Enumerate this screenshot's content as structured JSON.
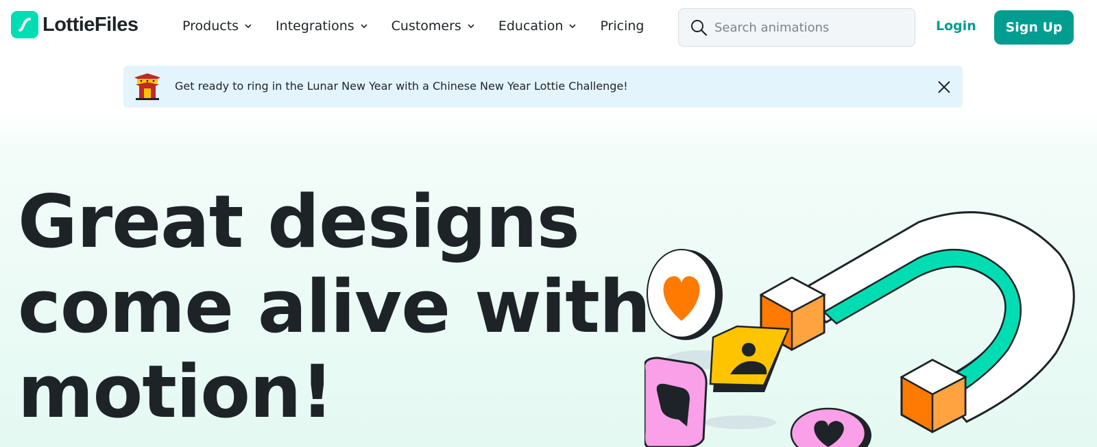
{
  "brand": {
    "name": "LottieFiles",
    "accent": "#00ddb3",
    "primary": "#019d91",
    "text": "#1d2327"
  },
  "nav": {
    "items": [
      {
        "label": "Products",
        "has_dropdown": true
      },
      {
        "label": "Integrations",
        "has_dropdown": true
      },
      {
        "label": "Customers",
        "has_dropdown": true
      },
      {
        "label": "Education",
        "has_dropdown": true
      },
      {
        "label": "Pricing",
        "has_dropdown": false
      }
    ]
  },
  "search": {
    "placeholder": "Search animations",
    "value": "",
    "icon": "search-icon"
  },
  "auth": {
    "login_label": "Login",
    "signup_label": "Sign Up"
  },
  "banner": {
    "icon": "chinese-temple-icon",
    "text": "Get ready to ring in the Lunar New Year with a Chinese New Year Lottie Challenge!",
    "close_icon": "close-icon",
    "background": "#e4f4fc"
  },
  "hero": {
    "title_lines": [
      "Great designs",
      "come alive with",
      "motion!"
    ]
  },
  "illustration": {
    "icons": [
      "magnet-icon",
      "heart-icon",
      "user-icon",
      "chat-bubble-icon",
      "heart-bubble-icon"
    ],
    "colors": {
      "teal": "#00ddb3",
      "orange": "#ff7a00",
      "yellow": "#ffc400",
      "pink": "#f9a0e8"
    }
  }
}
